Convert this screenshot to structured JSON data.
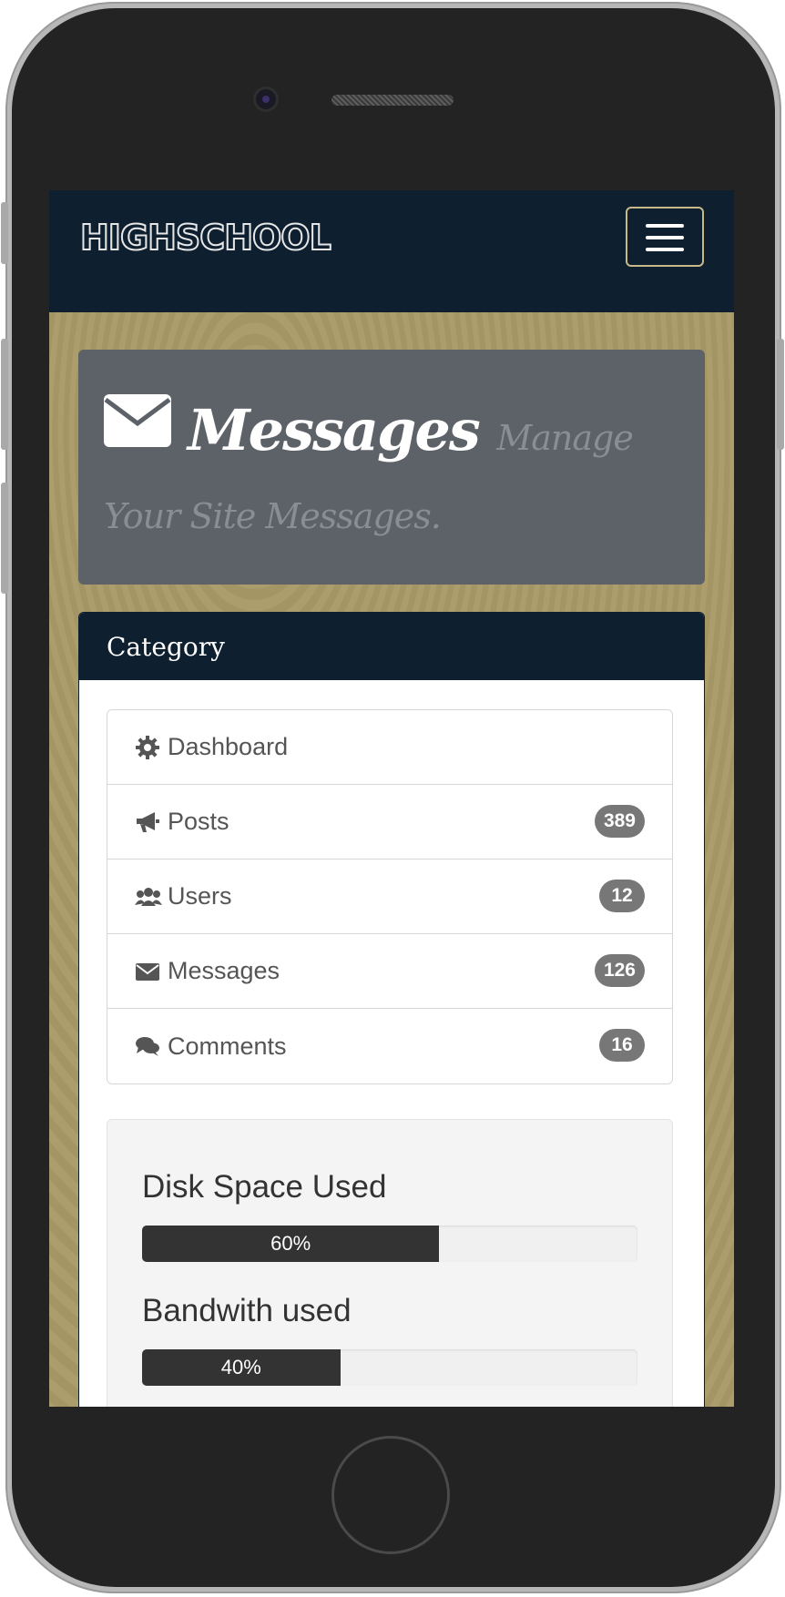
{
  "navbar": {
    "brand": "HIGHSCHOOL"
  },
  "header": {
    "title": "Messages",
    "subtitle": "Manage Your Site Messages."
  },
  "category_panel": {
    "heading": "Category",
    "items": [
      {
        "icon": "gear-icon",
        "label": "Dashboard",
        "badge": ""
      },
      {
        "icon": "bullhorn-icon",
        "label": "Posts",
        "badge": "389"
      },
      {
        "icon": "users-icon",
        "label": "Users",
        "badge": "12"
      },
      {
        "icon": "envelope-icon",
        "label": "Messages",
        "badge": "126"
      },
      {
        "icon": "comments-icon",
        "label": "Comments",
        "badge": "16"
      }
    ]
  },
  "stats": [
    {
      "label": "Disk Space Used",
      "value_label": "60%",
      "fraction": 0.6
    },
    {
      "label": "Bandwith used",
      "value_label": "40%",
      "fraction": 0.4
    }
  ],
  "colors": {
    "navbar": "#0e1f30",
    "background_wood": "#a99a67",
    "header_box": "#5d6168",
    "badge": "#777777",
    "progress_bar": "#333333"
  }
}
